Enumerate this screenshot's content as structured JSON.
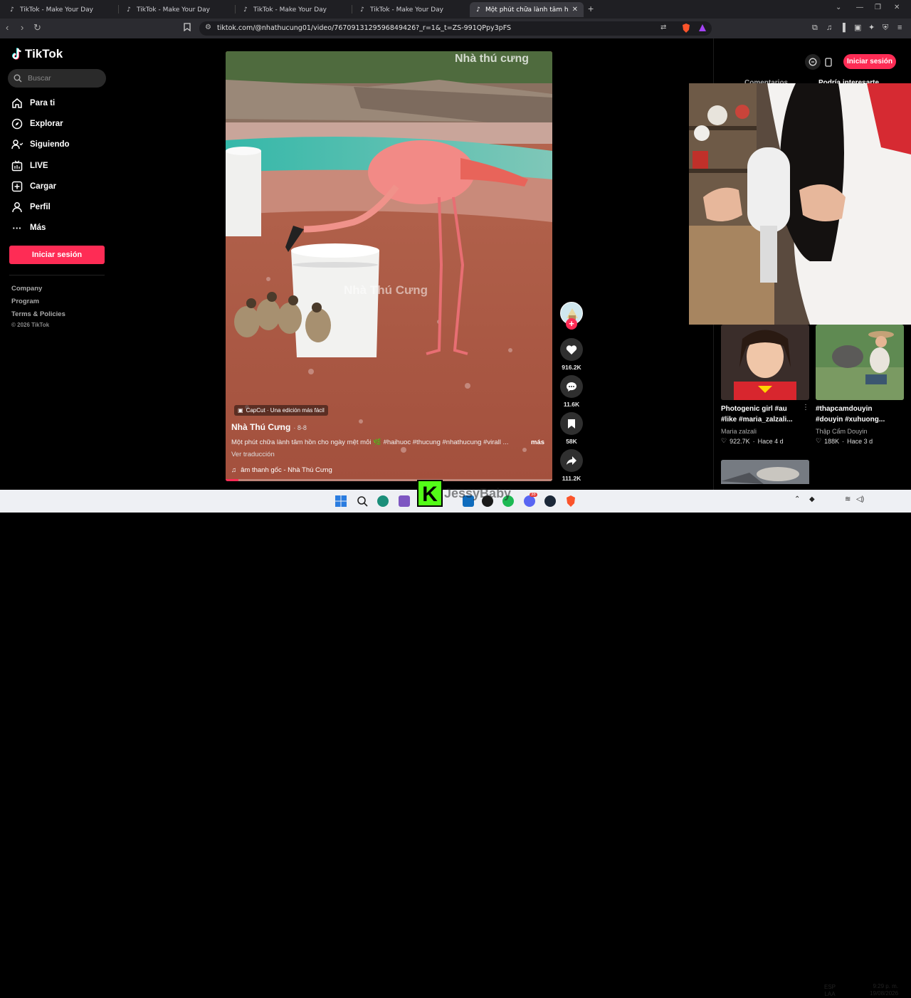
{
  "browser": {
    "tabs": [
      {
        "title": "TikTok - Make Your Day",
        "active": false
      },
      {
        "title": "TikTok - Make Your Day",
        "active": false
      },
      {
        "title": "TikTok - Make Your Day",
        "active": false
      },
      {
        "title": "TikTok - Make Your Day",
        "active": false
      },
      {
        "title": "Một phút chữa lành tâm hồn với",
        "active": true
      }
    ],
    "url": "tiktok.com/@nhathucung01/video/7670913129596849426?_r=1&_t=ZS-991QPpy3pFS",
    "new_tab_icon": "plus-icon"
  },
  "sidebar": {
    "logo": "TikTok",
    "search_placeholder": "Buscar",
    "items": [
      {
        "label": "Para ti",
        "icon": "home-icon"
      },
      {
        "label": "Explorar",
        "icon": "compass-icon"
      },
      {
        "label": "Siguiendo",
        "icon": "following-icon"
      },
      {
        "label": "LIVE",
        "icon": "live-icon"
      },
      {
        "label": "Cargar",
        "icon": "upload-icon"
      },
      {
        "label": "Perfil",
        "icon": "profile-icon"
      },
      {
        "label": "Más",
        "icon": "more-icon"
      }
    ],
    "login_label": "Iniciar sesión",
    "footer": [
      "Company",
      "Program",
      "Terms & Policies"
    ],
    "copyright": "© 2026 TikTok"
  },
  "video": {
    "watermark_top": "Nhà thú cưng",
    "watermark_mid": "Nhà Thú Cưng",
    "capcut_label": "CapCut · Una edición más fácil",
    "author": "Nhà Thú Cưng",
    "age": "· 8-8",
    "description": "Một phút chữa lành tâm hồn cho ngày mệt mỏi 🌿 #haihuoc #thucung #nhathucung #virall ...",
    "more_label": "más",
    "translate_label": "Ver traducción",
    "music": "âm thanh gốc - Nhà Thú Cưng",
    "progress": 0.04
  },
  "actions": {
    "likes": "916.2K",
    "comments": "11.6K",
    "saves": "58K",
    "shares": "111.2K"
  },
  "right_panel": {
    "login_label": "Iniciar sesión",
    "tab_comments": "Comentarios",
    "tab_interest": "Podría interesarte",
    "cards": [
      {
        "title": "Photogenic girl #au #like #maria_zalzali...",
        "author": "Maria zalzali",
        "likes": "922.7K",
        "age": "Hace 4 d"
      },
      {
        "title": "#thapcamdouyin #douyin #xuhuong...",
        "author": "Thập Cẩm Douyin",
        "likes": "188K",
        "age": "Hace 3 d"
      }
    ]
  },
  "overlay": {
    "streamer": "JessyBaby",
    "kick_letter": "K"
  },
  "taskbar": {
    "lang": "ESP",
    "region": "LAA",
    "time": "9:29 p. m.",
    "date": "19/08/2026",
    "discord_badge": "38"
  },
  "colors": {
    "accent": "#fe2c55",
    "kick_green": "#53fc18"
  }
}
